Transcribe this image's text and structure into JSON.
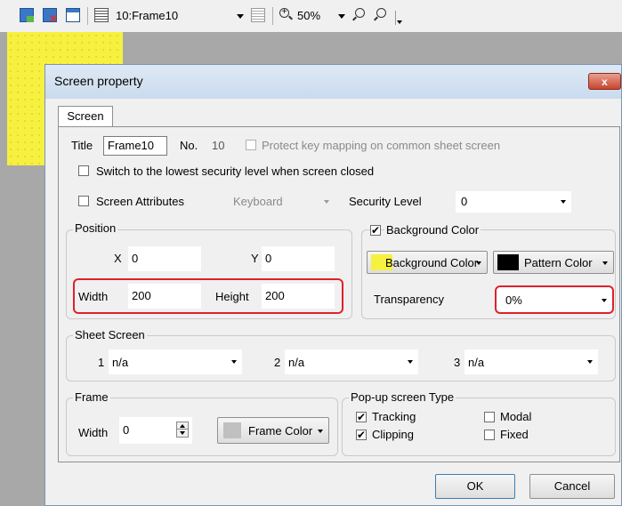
{
  "toolbar": {
    "frame_select": "10:Frame10",
    "zoom_value": "50%",
    "icons": [
      "add-screen-icon",
      "delete-screen-icon",
      "screen-property-icon",
      "frame-list-icon",
      "layer-icon",
      "zoom-in-icon",
      "zoom-out-icon",
      "zoom-fit-icon"
    ]
  },
  "dialog": {
    "title": "Screen property",
    "close_label": "x",
    "tab_label": "Screen",
    "title_label": "Title",
    "title_value": "Frame10",
    "no_label": "No.",
    "no_value": "10",
    "protect_key_label": "Protect key mapping on common sheet screen",
    "switch_security_label": "Switch to the lowest security level when screen closed",
    "screen_attributes_label": "Screen Attributes",
    "keyboard_value": "Keyboard",
    "security_level_label": "Security Level",
    "security_level_value": "0",
    "position": {
      "legend": "Position",
      "x_label": "X",
      "x_value": "0",
      "y_label": "Y",
      "y_value": "0",
      "width_label": "Width",
      "width_value": "200",
      "height_label": "Height",
      "height_value": "200"
    },
    "background": {
      "checkbox_label": "Background Color",
      "checked": "✔",
      "bg_color_button": "Background Color",
      "pattern_color_button": "Pattern Color",
      "transparency_label": "Transparency",
      "transparency_value": "0%",
      "bg_swatch_color": "#f6f040",
      "pattern_swatch_color": "#000000"
    },
    "sheet_screen": {
      "legend": "Sheet Screen",
      "items": [
        {
          "num": "1",
          "value": "n/a"
        },
        {
          "num": "2",
          "value": "n/a"
        },
        {
          "num": "3",
          "value": "n/a"
        }
      ]
    },
    "frame": {
      "legend": "Frame",
      "width_label": "Width",
      "width_value": "0",
      "color_button": "Frame Color"
    },
    "popup": {
      "legend": "Pop-up screen Type",
      "tracking_label": "Tracking",
      "tracking_checked": "✔",
      "modal_label": "Modal",
      "clipping_label": "Clipping",
      "clipping_checked": "✔",
      "fixed_label": "Fixed"
    },
    "ok_label": "OK",
    "cancel_label": "Cancel"
  },
  "colors": {
    "highlight": "#e0202e",
    "canvas_yellow": "#f6f040"
  }
}
